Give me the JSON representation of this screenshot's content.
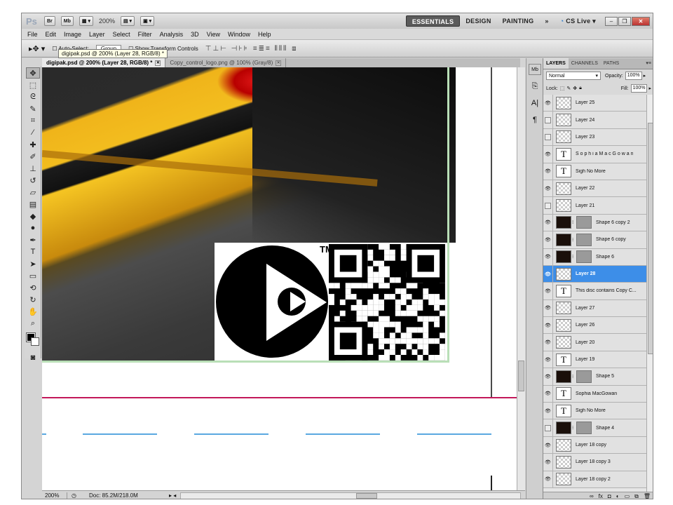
{
  "app": {
    "logo": "Ps",
    "zoom": "200%"
  },
  "workspace": {
    "items": [
      "ESSENTIALS",
      "DESIGN",
      "PAINTING",
      "»"
    ],
    "cslive": "CS Live ▾"
  },
  "menu": [
    "File",
    "Edit",
    "Image",
    "Layer",
    "Select",
    "Filter",
    "Analysis",
    "3D",
    "View",
    "Window",
    "Help"
  ],
  "options": {
    "auto_select": "Auto-Select:",
    "group": "Group",
    "show_transform": "Show Transform Controls"
  },
  "tooltip": "digipak.psd @ 200% (Layer 28, RGB/8) *",
  "doc_tabs": [
    {
      "label": "digipak.psd @ 200% (Layer 28, RGB/8) *"
    },
    {
      "label": "Copy_control_logo.png @ 100% (Gray/8)"
    }
  ],
  "status": {
    "zoom": "200%",
    "doc": "Doc: 85.2M/218.0M"
  },
  "panel": {
    "tabs": [
      "LAYERS",
      "CHANNELS",
      "PATHS"
    ],
    "blend_mode": "Normal",
    "opacity_label": "Opacity:",
    "opacity": "100%",
    "lock_label": "Lock:",
    "fill_label": "Fill:",
    "fill": "100%"
  },
  "layers": [
    {
      "name": "Layer 25",
      "type": "img",
      "visible": true
    },
    {
      "name": "Layer 24",
      "type": "img",
      "visible": false
    },
    {
      "name": "Layer 23",
      "type": "img",
      "visible": false
    },
    {
      "name": "S o p h i a  M a c G o w a n",
      "type": "text",
      "visible": true
    },
    {
      "name": "Sigh No More",
      "type": "text",
      "visible": true
    },
    {
      "name": "Layer 22",
      "type": "img",
      "visible": true
    },
    {
      "name": "Layer 21",
      "type": "img",
      "visible": false
    },
    {
      "name": "Shape 6 copy 2",
      "type": "shape",
      "visible": true
    },
    {
      "name": "Shape 6 copy",
      "type": "shape",
      "visible": true
    },
    {
      "name": "Shape 6",
      "type": "shape",
      "visible": true
    },
    {
      "name": "Layer 28",
      "type": "img",
      "visible": true,
      "selected": true
    },
    {
      "name": "This disc contains Copy C...",
      "type": "text",
      "visible": true
    },
    {
      "name": "Layer 27",
      "type": "img",
      "visible": true
    },
    {
      "name": "Layer 26",
      "type": "img",
      "visible": true
    },
    {
      "name": "Layer 20",
      "type": "img",
      "visible": true
    },
    {
      "name": "Layer 19",
      "type": "text",
      "visible": true
    },
    {
      "name": "Shape 5",
      "type": "shape",
      "visible": true
    },
    {
      "name": "Sophia MacGowan",
      "type": "text",
      "visible": true
    },
    {
      "name": "Sigh No More",
      "type": "text",
      "visible": true
    },
    {
      "name": "Shape 4",
      "type": "shape",
      "visible": false
    },
    {
      "name": "Layer 18 copy",
      "type": "img",
      "visible": true
    },
    {
      "name": "Layer 18 copy 3",
      "type": "img",
      "visible": true
    },
    {
      "name": "Layer 18 copy 2",
      "type": "img",
      "visible": true
    }
  ],
  "logo_tm": "TM",
  "colors": {
    "accent": "#3d8ee8",
    "guide_pink": "#c3185a",
    "guide_blue": "#5aa8e0"
  }
}
